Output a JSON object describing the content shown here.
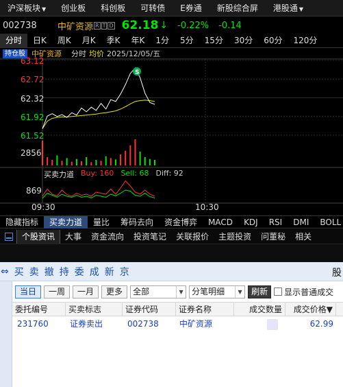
{
  "nav": [
    "沪深板块",
    "创业板",
    "科创板",
    "可转债",
    "E券通",
    "新股综合屏",
    "港股通"
  ],
  "quote": {
    "code": "002738",
    "name": "中矿资源",
    "rtd": [
      "R",
      "T",
      "D"
    ],
    "price": "62.18",
    "arrow": "↓",
    "pct": "-0.22%",
    "chg": "-0.14"
  },
  "periods": [
    "分时",
    "日K",
    "周K",
    "月K",
    "季K",
    "年K",
    "1分",
    "5分",
    "15分",
    "30分",
    "60分",
    "120分"
  ],
  "chart_head": {
    "badge": "持仓股",
    "name": "中矿资源",
    "type": "分时",
    "avg": "均价",
    "date": "2025/12/05/五"
  },
  "price_axis": [
    "63.12",
    "62.72",
    "62.32",
    "61.92",
    "61.52"
  ],
  "volume_axis": "2856",
  "bs_axis": "869",
  "time_axis": [
    "09:30",
    "10:30"
  ],
  "s_marker": "S",
  "bs": {
    "title": "买卖力道",
    "buy": "Buy: 160",
    "sell": "Sell: 68",
    "diff": "Diff: 92"
  },
  "indicator_tabs": [
    "隐藏指标",
    "买卖力道",
    "量比",
    "筹码去向",
    "资金博弈",
    "MACD",
    "KDJ",
    "RSI",
    "DMI",
    "BOLL"
  ],
  "info_tabs": [
    "个股资讯",
    "大事",
    "资金流向",
    "投资笔记",
    "关联报价",
    "主题投资",
    "问董秘",
    "相关"
  ],
  "trade_ops": [
    "买",
    "卖",
    "撤",
    "持",
    "委",
    "成",
    "新",
    "京"
  ],
  "trade_right": "股",
  "filters": {
    "today": "当日",
    "week": "一周",
    "month": "一月",
    "more": "更多",
    "scope": "全部",
    "detail": "分笔明细",
    "refresh": "刷新",
    "show_all": "显示普通成交"
  },
  "table": {
    "headers": [
      "委托编号",
      "买卖标志",
      "证券代码",
      "证券名称",
      "成交数量",
      "成交价格▼"
    ],
    "rows": [
      [
        "231760",
        "证券卖出",
        "002738",
        "中矿资源",
        "",
        "62.99"
      ]
    ]
  },
  "colors": {
    "up": "#ff3333",
    "down": "#00e600",
    "price_line": "#ffffff",
    "avg_line": "#e6e600",
    "accent": "#1f4fb8"
  },
  "chart_data": {
    "type": "line",
    "time_axis": [
      "09:30",
      "10:30"
    ],
    "price_ticks": [
      63.12,
      62.72,
      62.32,
      61.92,
      61.52
    ],
    "ylim": [
      61.52,
      63.12
    ],
    "series": [
      {
        "values": [
          61.66,
          61.93,
          61.98,
          61.92,
          61.96,
          61.9,
          62.0,
          61.95,
          62.1,
          62.02,
          62.12,
          62.05,
          62.2,
          62.08,
          62.28,
          62.24,
          62.4,
          62.6,
          62.84,
          62.96,
          62.75,
          62.42,
          62.22,
          62.18
        ]
      },
      {
        "values": [
          61.66,
          61.82,
          61.88,
          61.9,
          61.91,
          61.91,
          61.92,
          61.93,
          61.94,
          61.95,
          61.96,
          61.97,
          61.99,
          62.0,
          62.02,
          62.04,
          62.08,
          62.13,
          62.19,
          62.24,
          62.26,
          62.27,
          62.26,
          62.24
        ]
      }
    ],
    "volume": {
      "max": 2856,
      "values": [
        2700,
        900,
        600,
        1100,
        500,
        800,
        400,
        700,
        450,
        900,
        350,
        600,
        500,
        1000,
        800,
        650,
        1200,
        1600,
        2200,
        2856,
        1500,
        900,
        700,
        600
      ]
    },
    "buy_sell": {
      "max": 869,
      "buy": 160,
      "sell": 68,
      "diff": 92
    }
  }
}
